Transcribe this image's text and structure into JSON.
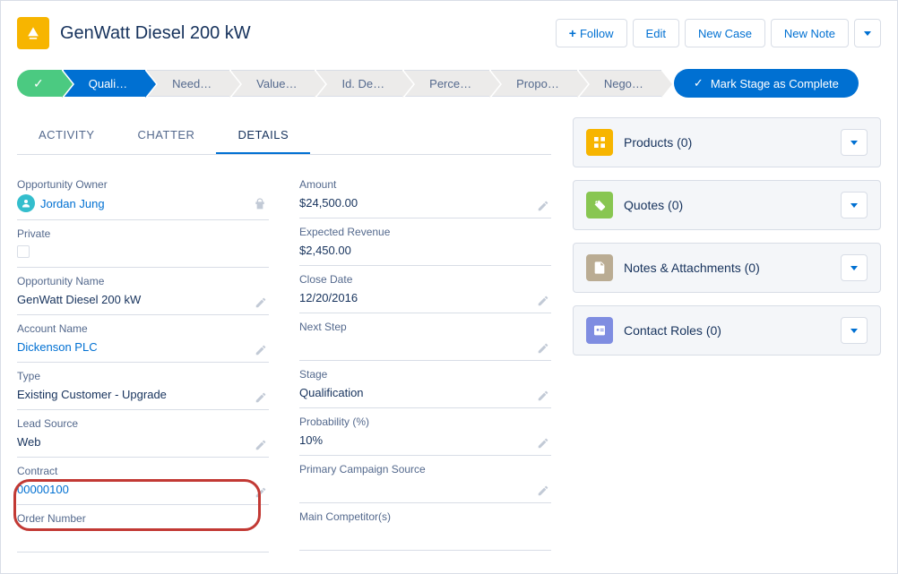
{
  "header": {
    "title": "GenWatt Diesel 200 kW",
    "actions": {
      "follow": "Follow",
      "edit": "Edit",
      "new_case": "New Case",
      "new_note": "New Note"
    }
  },
  "stages": {
    "items": [
      "Quali…",
      "Need…",
      "Value…",
      "Id. De…",
      "Perce…",
      "Propo…",
      "Nego…"
    ],
    "mark_complete": "Mark Stage as Complete"
  },
  "tabs": {
    "activity": "ACTIVITY",
    "chatter": "CHATTER",
    "details": "DETAILS"
  },
  "details": {
    "left": [
      {
        "label": "Opportunity Owner",
        "value": "Jordan Jung",
        "link": true,
        "owner": true
      },
      {
        "label": "Private",
        "value": "",
        "checkbox": true
      },
      {
        "label": "Opportunity Name",
        "value": "GenWatt Diesel 200 kW",
        "editable": true
      },
      {
        "label": "Account Name",
        "value": "Dickenson PLC",
        "link": true,
        "editable": true
      },
      {
        "label": "Type",
        "value": "Existing Customer - Upgrade",
        "editable": true
      },
      {
        "label": "Lead Source",
        "value": "Web",
        "editable": true
      },
      {
        "label": "Contract",
        "value": "00000100",
        "link": true,
        "editable": true
      },
      {
        "label": "Order Number",
        "value": ""
      }
    ],
    "right": [
      {
        "label": "Amount",
        "value": "$24,500.00",
        "editable": true
      },
      {
        "label": "Expected Revenue",
        "value": "$2,450.00"
      },
      {
        "label": "Close Date",
        "value": "12/20/2016",
        "editable": true
      },
      {
        "label": "Next Step",
        "value": "",
        "editable": true
      },
      {
        "label": "Stage",
        "value": "Qualification",
        "editable": true
      },
      {
        "label": "Probability (%)",
        "value": "10%",
        "editable": true
      },
      {
        "label": "Primary Campaign Source",
        "value": "",
        "editable": true
      },
      {
        "label": "Main Competitor(s)",
        "value": ""
      }
    ]
  },
  "sidebar": {
    "cards": [
      {
        "title": "Products (0)",
        "icon": "products"
      },
      {
        "title": "Quotes (0)",
        "icon": "quotes"
      },
      {
        "title": "Notes & Attachments (0)",
        "icon": "notes"
      },
      {
        "title": "Contact Roles (0)",
        "icon": "contacts"
      }
    ]
  }
}
